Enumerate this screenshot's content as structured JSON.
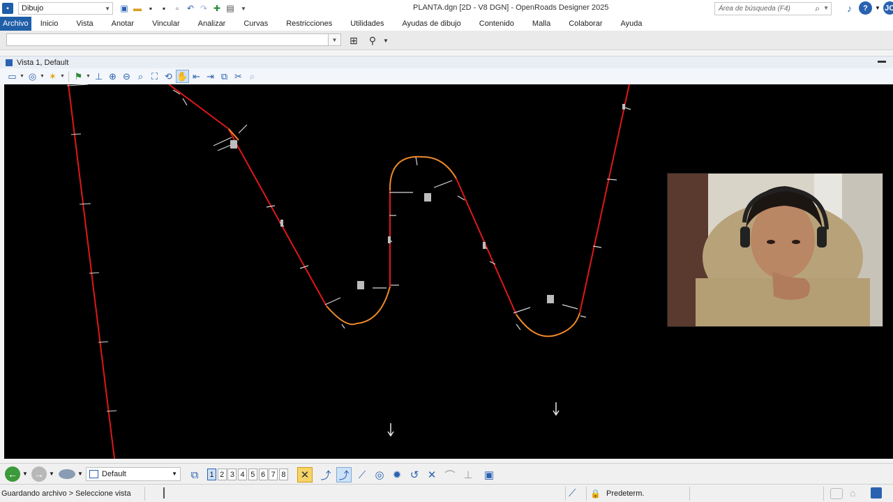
{
  "titlebar": {
    "workflow": "Dibujo",
    "title": "PLANTA.dgn [2D - V8 DGN] - OpenRoads Designer 2025",
    "search_placeholder": "Área de búsqueda (F4)",
    "user_initials": "JO"
  },
  "menu": {
    "items": [
      "Archivo",
      "Inicio",
      "Vista",
      "Anotar",
      "Vincular",
      "Analizar",
      "Curvas",
      "Restricciones",
      "Utilidades",
      "Ayudas de dibujo",
      "Contenido",
      "Malla",
      "Colaborar",
      "Ayuda"
    ]
  },
  "view": {
    "title": "Vista 1, Default"
  },
  "bottom": {
    "view_group": "Default",
    "view_numbers": [
      "1",
      "2",
      "3",
      "4",
      "5",
      "6",
      "7",
      "8"
    ]
  },
  "status": {
    "message": "Guardando archivo > Seleccione vista",
    "level": "Predeterm."
  },
  "colors": {
    "tangent": "#e01818",
    "curve": "#f08a28",
    "accent": "#1f5fa8"
  },
  "icons": {
    "titlebar": [
      "app-icon",
      "view-toggle-icon",
      "open-icon",
      "save-icon",
      "save-all-icon",
      "copy-icon",
      "undo-icon",
      "redo-icon",
      "pin-icon",
      "print-icon"
    ],
    "status": [
      "snap-icon",
      "lock-icon"
    ]
  }
}
